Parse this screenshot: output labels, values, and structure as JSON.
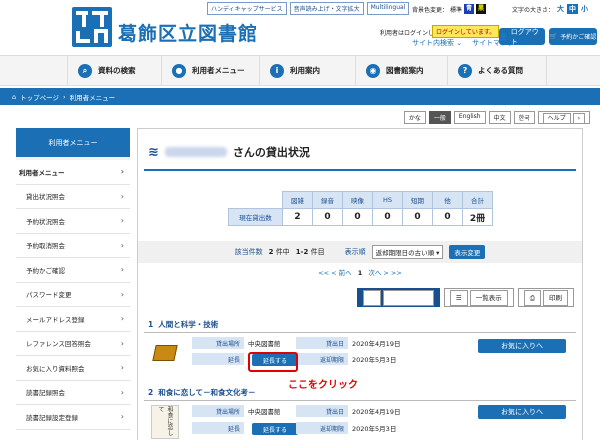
{
  "header": {
    "logo_title": "葛飾区立図書館",
    "util_links": [
      "ハンディキャップサービス",
      "音声読み上げ・文字拡大",
      "Multilingual"
    ],
    "bg_color_label": "背景色変更：",
    "bg_standard": "標準",
    "bg_blue": "青",
    "bg_black": "黒",
    "font_size_label": "文字の大きさ：",
    "font_large": "大",
    "font_medium": "中",
    "font_small": "小",
    "login_note": "利用者はログインしています。",
    "login_badge": "ログインしています。",
    "site_search": "サイト内検索",
    "sitemap": "サイトマップ",
    "logout": "ログアウト",
    "cart": "予約かご確認"
  },
  "nav": {
    "items": [
      {
        "icon": "search-icon",
        "label": "資料の検索"
      },
      {
        "icon": "user-icon",
        "label": "利用者メニュー"
      },
      {
        "icon": "info-icon",
        "label": "利用案内"
      },
      {
        "icon": "map-pin-icon",
        "label": "図書館案内"
      },
      {
        "icon": "question-icon",
        "label": "よくある質問"
      }
    ]
  },
  "breadcrumb": {
    "home": "トップページ",
    "current": "利用者メニュー"
  },
  "lang": [
    "かな",
    "一般",
    "English",
    "中文",
    "한국",
    "ヘルプ"
  ],
  "sidebar": {
    "title": "利用者メニュー",
    "top_item": "利用者メニュー",
    "items": [
      "貸出状況照会",
      "予約状況照会",
      "予約取消照会",
      "予約かご確認",
      "パスワード変更",
      "メールアドレス登録",
      "レファレンス回答照会",
      "お気に入り資料照会",
      "読書記録照会",
      "読書記録設定登録"
    ]
  },
  "panel": {
    "title_suffix": "さんの貸出状況",
    "stats": {
      "headers": [
        "図雑",
        "録音",
        "映像",
        "HS",
        "短期",
        "他",
        "合計"
      ],
      "row_label": "現在貸出数",
      "values": [
        "2",
        "0",
        "0",
        "0",
        "0",
        "0",
        "2冊"
      ]
    },
    "count": {
      "label": "該当件数",
      "total": "2",
      "unit": "件中",
      "range": "1-2",
      "unit2": "件目",
      "order_label": "表示順",
      "order_value": "返却期限日の古い順",
      "change_btn": "表示変更"
    },
    "pager": {
      "prev": "<< < 前へ",
      "page": "1",
      "next": "次へ > >>"
    },
    "view_buttons": {
      "icon_view": "アイコン表示",
      "list_view": "一覧表示",
      "print": "印刷"
    },
    "items": [
      {
        "num": "1",
        "title": "人間と科学・技術",
        "place_label": "貸出場所",
        "place": "中央図書館",
        "date_label": "貸出日",
        "date": "2020年4月19日",
        "extend_label": "延長",
        "extend_btn": "延長する",
        "due_label": "返却期限",
        "due": "2020年5月3日",
        "fav": "お気に入りへ"
      },
      {
        "num": "2",
        "title": "和食に恋して－和食文化考－",
        "place_label": "貸出場所",
        "place": "中央図書館",
        "date_label": "貸出日",
        "date": "2020年4月19日",
        "extend_label": "延長",
        "extend_btn": "延長する",
        "due_label": "返却期限",
        "due": "2020年5月3日",
        "fav": "お気に入りへ",
        "cover_text": "和食に恋して"
      }
    ],
    "annotation": "ここをクリック"
  }
}
